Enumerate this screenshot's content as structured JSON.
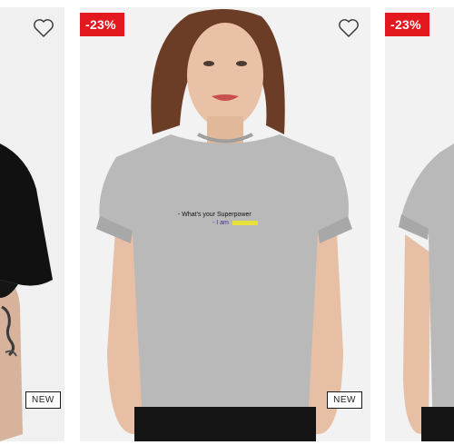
{
  "products": [
    {
      "position": "left",
      "badge_new": "NEW",
      "favorite_icon": "heart-outline-icon",
      "shirt_color": "#111111"
    },
    {
      "position": "center",
      "discount": "-23%",
      "badge_new": "NEW",
      "favorite_icon": "heart-outline-icon",
      "shirt_color": "#b8b8b8",
      "print_text_line1": "- What's your Superpower",
      "print_text_line2": "- I am"
    },
    {
      "position": "right",
      "discount": "-23%",
      "shirt_color": "#b8b8b8"
    }
  ],
  "colors": {
    "discount_bg": "#e3171e",
    "card_bg": "#f0f0f0"
  }
}
